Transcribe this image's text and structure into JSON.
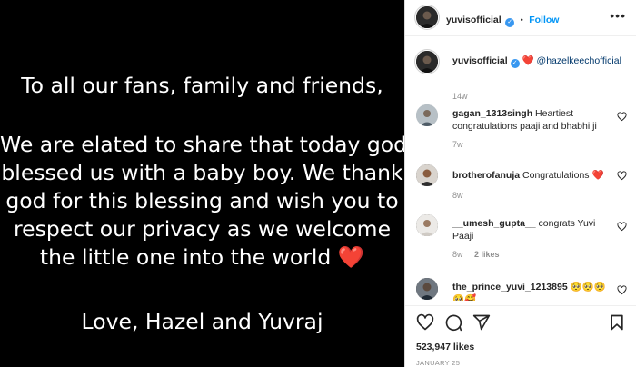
{
  "post": {
    "lines": [
      "To all our fans, family and friends,",
      "We are elated to share that today god",
      "blessed us with a baby boy. We thank",
      "god for this blessing and wish you to",
      "respect our privacy as we welcome",
      "the little one into the world ❤️",
      "Love, Hazel and Yuvraj"
    ]
  },
  "header": {
    "username": "yuvisofficial",
    "separator": "•",
    "follow_label": "Follow",
    "more": "•••"
  },
  "caption": {
    "username": "yuvisofficial",
    "emoji": "❤️",
    "mention": "@hazelkeechofficial",
    "time": "14w"
  },
  "comments": [
    {
      "username": "gagan_1313singh",
      "text": "Heartiest congratulations paaji and bhabhi ji",
      "time": "7w",
      "likes": ""
    },
    {
      "username": "brotherofanuja",
      "text": "Congratulations ❤️",
      "time": "8w",
      "likes": ""
    },
    {
      "username": "__umesh_gupta__",
      "text": "congrats Yuvi Paaji",
      "time": "8w",
      "likes": "2 likes"
    },
    {
      "username": "the_prince_yuvi_1213895",
      "text": "🥺🥺🥺 🥺🥰",
      "time": "",
      "likes": ""
    }
  ],
  "footer": {
    "likes": "523,947 likes",
    "date": "JANUARY 25"
  },
  "colors": {
    "accent": "#0095f6",
    "heart": "#ed4956",
    "verified": "#3897f0"
  },
  "icons": [
    "heart-icon",
    "comment-icon",
    "share-icon",
    "bookmark-icon",
    "verified-badge-icon",
    "more-options-icon"
  ]
}
